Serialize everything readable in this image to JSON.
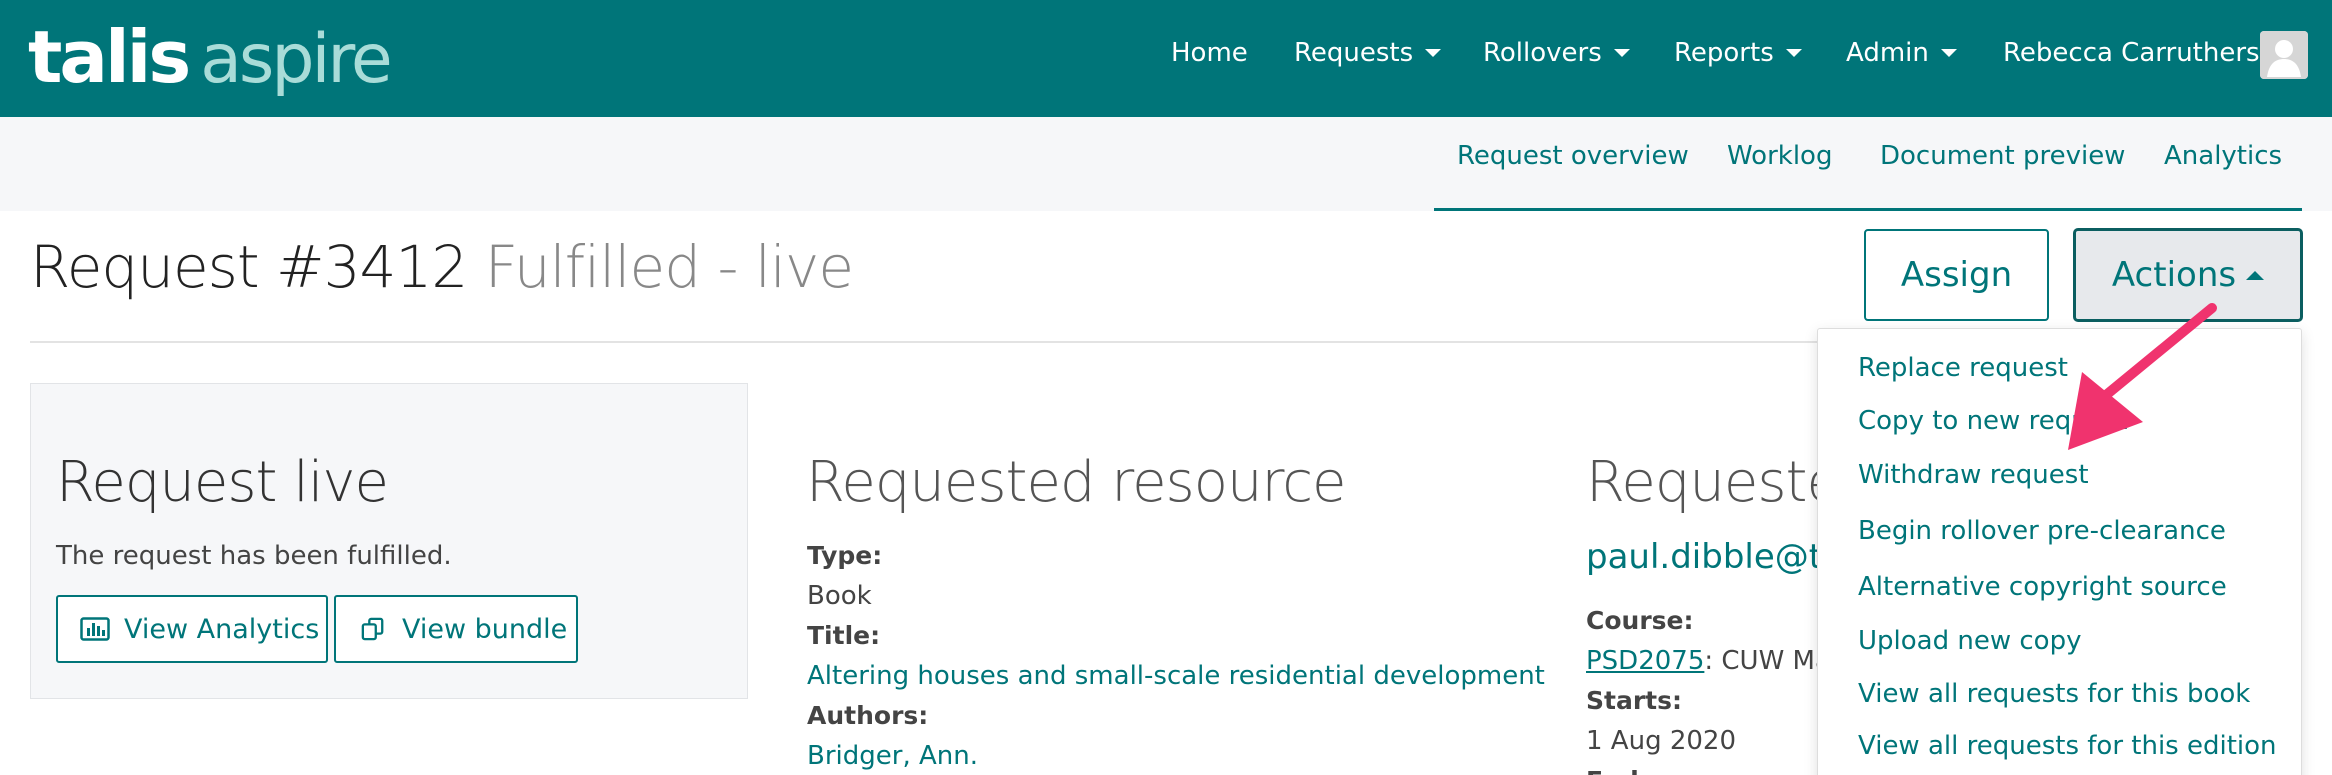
{
  "header": {
    "logo_main": "talis",
    "logo_sub": "aspire",
    "nav": [
      {
        "label": "Home",
        "has_dropdown": false
      },
      {
        "label": "Requests",
        "has_dropdown": true
      },
      {
        "label": "Rollovers",
        "has_dropdown": true
      },
      {
        "label": "Reports",
        "has_dropdown": true
      },
      {
        "label": "Admin",
        "has_dropdown": true
      }
    ],
    "user_name": "Rebecca Carruthers",
    "avatar_icon": "user-avatar-icon"
  },
  "subnav": {
    "items": [
      "Request overview",
      "Worklog",
      "Document preview",
      "Analytics"
    ],
    "active": "Request overview"
  },
  "page": {
    "title": "Request #3412",
    "status": "Fulfilled - live",
    "assign_label": "Assign",
    "actions_label": "Actions"
  },
  "actions_menu": {
    "items": [
      "Replace request",
      "Copy to new request",
      "Withdraw request",
      "Begin rollover pre-clearance",
      "Alternative copyright source",
      "Upload new copy",
      "View all requests for this book",
      "View all requests for this edition"
    ]
  },
  "status_panel": {
    "title": "Request live",
    "text": "The request has been fulfilled.",
    "view_analytics_label": "View Analytics",
    "view_bundle_label": "View bundle"
  },
  "resource": {
    "section_title": "Requested resource",
    "type_label": "Type:",
    "type_value": "Book",
    "title_label": "Title:",
    "title_value": "Altering houses and small-scale residential development",
    "authors_label": "Authors:",
    "authors_value": "Bridger, Ann."
  },
  "requester": {
    "section_title": "Requested by",
    "email": "paul.dibble@talis.com",
    "course_label": "Course:",
    "course_code": "PSD2075",
    "course_name": ": CUW Management",
    "starts_label": "Starts:",
    "starts_value": "1 Aug 2020",
    "ends_label": "Ends:"
  },
  "colors": {
    "brand": "#007579",
    "logo_sub": "#a9dcd8",
    "subnav_bg": "#f6f7f9",
    "annotation_arrow": "#f0336e"
  }
}
